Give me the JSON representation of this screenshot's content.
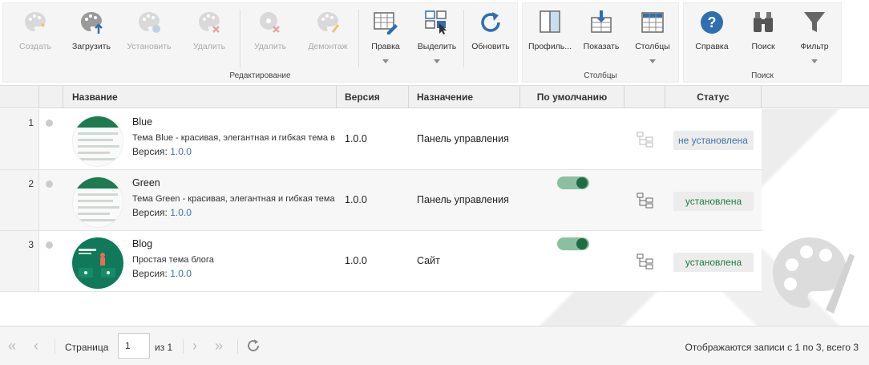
{
  "ribbon": {
    "edit_group": {
      "title": "Редактирование",
      "create": "Создать",
      "upload": "Загрузить",
      "install": "Установить",
      "delete": "Удалить",
      "remove": "Удалить",
      "uninstall": "Демонтаж",
      "edit": "Правка",
      "select": "Выделить",
      "refresh": "Обновить"
    },
    "columns_group": {
      "title": "Столбцы",
      "profile": "Профиль...",
      "show": "Показать",
      "columns": "Столбцы"
    },
    "search_group": {
      "title": "Поиск",
      "help": "Справка",
      "search": "Поиск",
      "filter": "Фильтр"
    }
  },
  "grid": {
    "headers": {
      "name": "Название",
      "version": "Версия",
      "purpose": "Назначение",
      "default": "По умолчанию",
      "status": "Статус"
    },
    "rows": [
      {
        "num": "1",
        "name": "Blue",
        "desc": "Тема Blue - красивая, элегантная и гибкая тема в ц",
        "ver_label": "Версия:",
        "ver": "1.0.0",
        "version": "1.0.0",
        "purpose": "Панель управления",
        "is_default": false,
        "status": "не установлена"
      },
      {
        "num": "2",
        "name": "Green",
        "desc": "Тема Green - красивая, элегантная и гибкая тема в",
        "ver_label": "Версия:",
        "ver": "1.0.0",
        "version": "1.0.0",
        "purpose": "Панель управления",
        "is_default": true,
        "status": "установлена"
      },
      {
        "num": "3",
        "name": "Blog",
        "desc": "Простая тема блога",
        "ver_label": "Версия:",
        "ver": "1.0.0",
        "version": "1.0.0",
        "purpose": "Сайт",
        "is_default": true,
        "status": "установлена"
      }
    ]
  },
  "pager": {
    "page_label": "Страница",
    "page": "1",
    "of": "из 1",
    "info": "Отображаются записи с 1 по 3, всего 3"
  },
  "colors": {
    "accent_blue": "#3b74ad",
    "installed_green": "#1f7a45",
    "toggle_on": "#1e6d44"
  }
}
